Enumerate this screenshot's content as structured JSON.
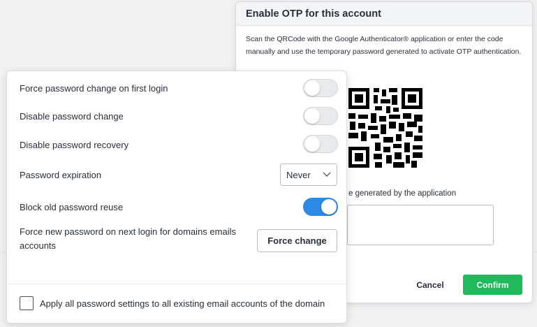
{
  "otp_dialog": {
    "title": "Enable OTP for this account",
    "description": "Scan the QRCode with the Google Authenticator® application or enter the code manually and use the temporary password generated to activate OTP authentication.",
    "code_label": "e generated by the application",
    "code_value": "",
    "cancel_label": "Cancel",
    "confirm_label": "Confirm",
    "confirm_color": "#20b95c"
  },
  "password_settings": {
    "rows": [
      {
        "label": "Force password change on first login",
        "enabled": false
      },
      {
        "label": "Disable password change",
        "enabled": false
      },
      {
        "label": "Disable password recovery",
        "enabled": false
      }
    ],
    "expiration": {
      "label": "Password expiration",
      "selected": "Never"
    },
    "block_reuse": {
      "label": "Block old password reuse",
      "enabled": true
    },
    "force_new": {
      "label": "Force new password on next login for domains emails accounts",
      "button_label": "Force change"
    },
    "apply_all": {
      "label": "Apply all password settings to all existing email accounts of the domain",
      "checked": false
    },
    "toggle_on_color": "#2d89e6"
  }
}
